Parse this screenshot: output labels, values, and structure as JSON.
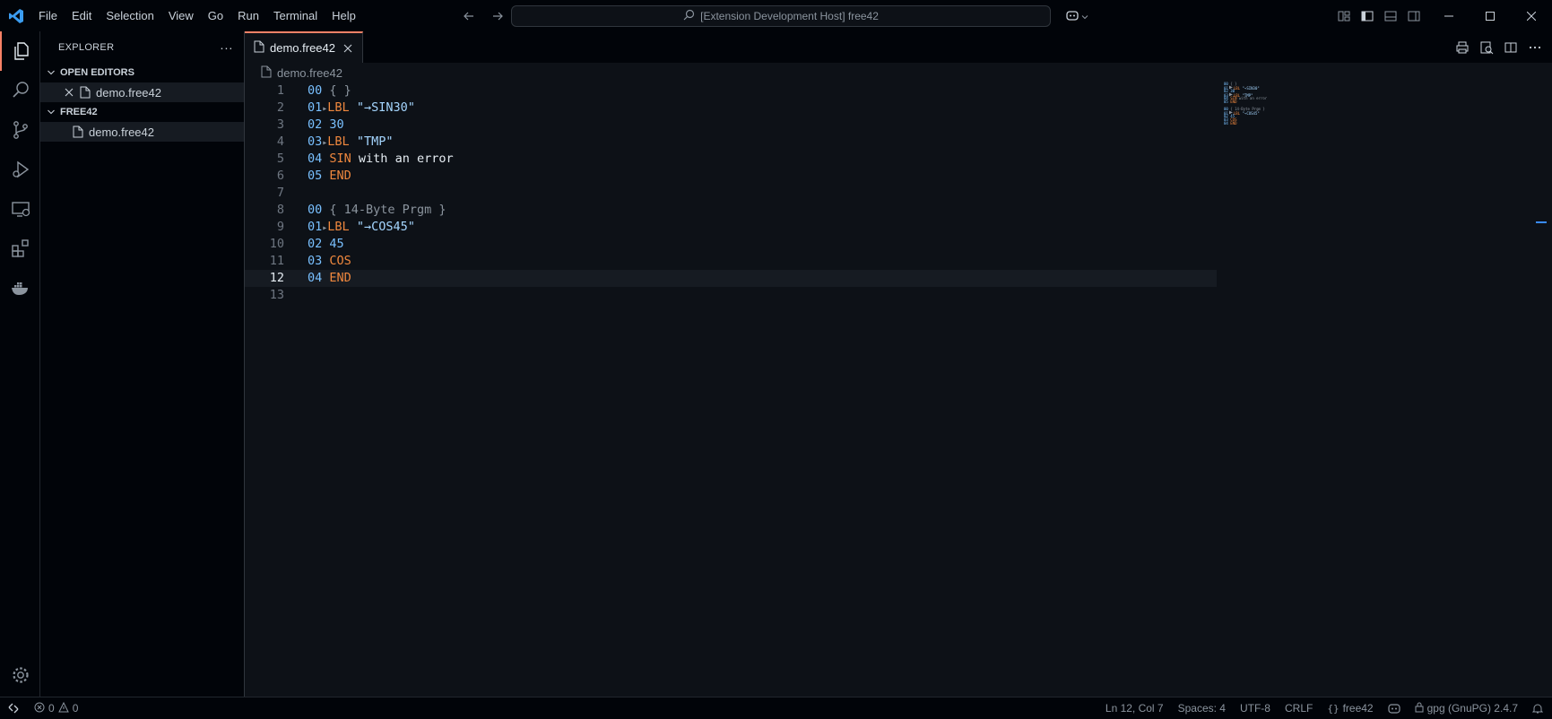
{
  "titlebar": {
    "menu": [
      "File",
      "Edit",
      "Selection",
      "View",
      "Go",
      "Run",
      "Terminal",
      "Help"
    ],
    "command_center": "[Extension Development Host] free42"
  },
  "activity_bar": {
    "items": [
      "explorer-icon",
      "search-icon",
      "source-control-icon",
      "run-debug-icon",
      "remote-explorer-icon",
      "extensions-icon",
      "docker-icon"
    ],
    "bottom": "settings-icon"
  },
  "sidebar": {
    "title": "EXPLORER",
    "more": "···",
    "open_editors_title": "OPEN EDITORS",
    "open_editors": [
      {
        "label": "demo.free42"
      }
    ],
    "folder_title": "FREE42",
    "files": [
      {
        "label": "demo.free42"
      }
    ]
  },
  "editor": {
    "tab": {
      "label": "demo.free42"
    },
    "breadcrumb": "demo.free42",
    "current_line": 12,
    "lines": [
      {
        "n": "1",
        "seg": [
          [
            "num",
            "00"
          ],
          [
            "plain",
            " "
          ],
          [
            "cmt",
            "{ }"
          ]
        ]
      },
      {
        "n": "2",
        "seg": [
          [
            "num",
            "01"
          ],
          [
            "arrow",
            "▸"
          ],
          [
            "kw",
            "LBL"
          ],
          [
            "plain",
            " "
          ],
          [
            "str",
            "\"→SIN30\""
          ]
        ]
      },
      {
        "n": "3",
        "seg": [
          [
            "num",
            "02"
          ],
          [
            "plain",
            " "
          ],
          [
            "num",
            "30"
          ]
        ]
      },
      {
        "n": "4",
        "seg": [
          [
            "num",
            "03"
          ],
          [
            "arrow",
            "▸"
          ],
          [
            "kw",
            "LBL"
          ],
          [
            "plain",
            " "
          ],
          [
            "str",
            "\"TMP\""
          ]
        ]
      },
      {
        "n": "5",
        "seg": [
          [
            "num",
            "04"
          ],
          [
            "plain",
            " "
          ],
          [
            "kw",
            "SIN"
          ],
          [
            "plain",
            " with an error"
          ]
        ]
      },
      {
        "n": "6",
        "seg": [
          [
            "num",
            "05"
          ],
          [
            "plain",
            " "
          ],
          [
            "kw",
            "END"
          ]
        ]
      },
      {
        "n": "7",
        "seg": []
      },
      {
        "n": "8",
        "seg": [
          [
            "num",
            "00"
          ],
          [
            "plain",
            " "
          ],
          [
            "cmt",
            "{ 14-Byte Prgm }"
          ]
        ]
      },
      {
        "n": "9",
        "seg": [
          [
            "num",
            "01"
          ],
          [
            "arrow",
            "▸"
          ],
          [
            "kw",
            "LBL"
          ],
          [
            "plain",
            " "
          ],
          [
            "str",
            "\"→COS45\""
          ]
        ]
      },
      {
        "n": "10",
        "seg": [
          [
            "num",
            "02"
          ],
          [
            "plain",
            " "
          ],
          [
            "num",
            "45"
          ]
        ]
      },
      {
        "n": "11",
        "seg": [
          [
            "num",
            "03"
          ],
          [
            "plain",
            " "
          ],
          [
            "kw",
            "COS"
          ]
        ]
      },
      {
        "n": "12",
        "seg": [
          [
            "num",
            "04"
          ],
          [
            "plain",
            " "
          ],
          [
            "kw",
            "END"
          ]
        ]
      },
      {
        "n": "13",
        "seg": []
      }
    ]
  },
  "statusbar": {
    "errors": "0",
    "warnings": "0",
    "position": "Ln 12, Col 7",
    "spaces": "Spaces: 4",
    "encoding": "UTF-8",
    "eol": "CRLF",
    "language": "free42",
    "gpg": "gpg (GnuPG) 2.4.7"
  },
  "colors": {
    "accent": "#f78166",
    "number": "#79c0ff",
    "keyword": "#f0883e",
    "string": "#a5d6ff",
    "comment": "#8b949e"
  }
}
